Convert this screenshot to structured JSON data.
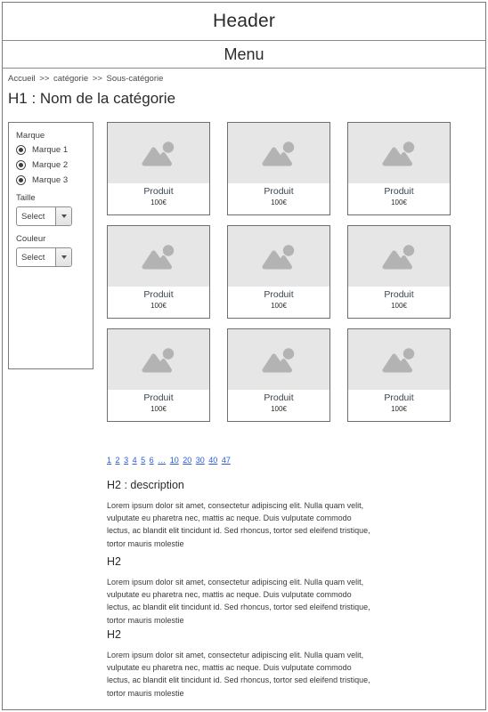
{
  "header": {
    "title": "Header"
  },
  "menu": {
    "title": "Menu"
  },
  "breadcrumb": {
    "items": [
      "Accueil",
      "catégorie",
      "Sous-catégorie"
    ],
    "separator": ">>"
  },
  "page_title": "H1 : Nom de la catégorie",
  "sidebar": {
    "brand_filter": {
      "title": "Marque",
      "options": [
        {
          "label": "Marque 1",
          "selected": true
        },
        {
          "label": "Marque 2",
          "selected": true
        },
        {
          "label": "Marque 3",
          "selected": true
        }
      ]
    },
    "size_filter": {
      "label": "Taille",
      "value": "Select",
      "icon": "chevron-down-icon"
    },
    "color_filter": {
      "label": "Couleur",
      "value": "Select",
      "icon": "chevron-down-icon"
    }
  },
  "products": [
    {
      "name": "Produit",
      "price": "100€",
      "image": "image-placeholder-icon"
    },
    {
      "name": "Produit",
      "price": "100€",
      "image": "image-placeholder-icon"
    },
    {
      "name": "Produit",
      "price": "100€",
      "image": "image-placeholder-icon"
    },
    {
      "name": "Produit",
      "price": "100€",
      "image": "image-placeholder-icon"
    },
    {
      "name": "Produit",
      "price": "100€",
      "image": "image-placeholder-icon"
    },
    {
      "name": "Produit",
      "price": "100€",
      "image": "image-placeholder-icon"
    },
    {
      "name": "Produit",
      "price": "100€",
      "image": "image-placeholder-icon"
    },
    {
      "name": "Produit",
      "price": "100€",
      "image": "image-placeholder-icon"
    },
    {
      "name": "Produit",
      "price": "100€",
      "image": "image-placeholder-icon"
    }
  ],
  "pagination": {
    "pages": [
      "1",
      "2",
      "3",
      "4",
      "5",
      "6"
    ],
    "ellipsis": "…",
    "jump_pages": [
      "10",
      "20",
      "30",
      "40",
      "47"
    ],
    "link_color": "#2a5bd7"
  },
  "sections": [
    {
      "heading": "H2 : description",
      "body": "Lorem ipsum dolor sit amet, consectetur adipiscing elit. Nulla quam velit, vulputate eu pharetra nec, mattis ac neque. Duis vulputate commodo lectus, ac blandit elit tincidunt id. Sed rhoncus, tortor sed eleifend tristique, tortor mauris molestie"
    },
    {
      "heading": "H2",
      "body": "Lorem ipsum dolor sit amet, consectetur adipiscing elit. Nulla quam velit, vulputate eu pharetra nec, mattis ac neque. Duis vulputate commodo lectus, ac blandit elit tincidunt id. Sed rhoncus, tortor sed eleifend tristique, tortor mauris molestie"
    },
    {
      "heading": "H2",
      "body": "Lorem ipsum dolor sit amet, consectetur adipiscing elit. Nulla quam velit, vulputate eu pharetra nec, mattis ac neque. Duis vulputate commodo lectus, ac blandit elit tincidunt id. Sed rhoncus, tortor sed eleifend tristique, tortor mauris molestie"
    }
  ],
  "colors": {
    "frame_border": "#7a7a7a",
    "card_border": "#6f6f6f",
    "thumb_bg": "#e6e6e6",
    "placeholder_icon": "#b3b3b3",
    "text": "#2b2b2b"
  }
}
